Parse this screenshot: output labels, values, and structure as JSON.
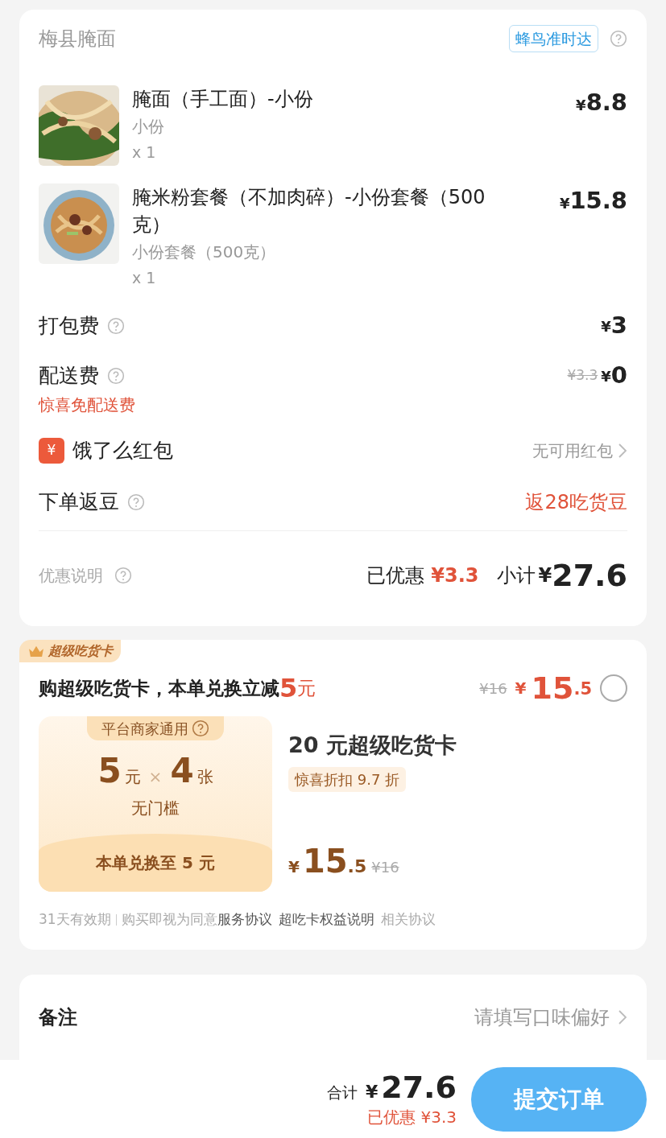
{
  "shop": {
    "name": "梅县腌面",
    "delivery_badge": "蜂鸟准时达"
  },
  "items": [
    {
      "name": "腌面（手工面）-小份",
      "spec": "小份",
      "quantity": "x 1",
      "symbol": "¥",
      "amount": "8.8",
      "kind": "picture"
    },
    {
      "name": "腌米粉套餐（不加肉碎）-小份套餐（500克）",
      "spec": "小份套餐（500克）",
      "quantity": "x 1",
      "symbol": "¥",
      "amount": "15.8",
      "kind": "picture"
    }
  ],
  "fees": [
    {
      "label": "打包费",
      "symbol": "¥",
      "amount": "3"
    },
    {
      "label": "配送费",
      "original": "¥3.3",
      "symbol": "¥",
      "amount": "0",
      "note": "惊喜免配送费"
    }
  ],
  "red_packet": {
    "icon": "¥",
    "label": "饿了么红包",
    "value": "无可用红包"
  },
  "beans": {
    "label": "下单返豆",
    "value": "返28吃货豆"
  },
  "summary": {
    "label": "优惠说明",
    "discount_label": "已优惠",
    "discount": "¥3.3",
    "subtotal_label": "小计",
    "symbol": "¥",
    "subtotal": "27.6"
  },
  "super_card": {
    "tag": "超级吃货卡",
    "headline": "购超级吃货卡，本单兑换立减",
    "headline_amount": "5",
    "headline_unit": "元",
    "original": "¥16",
    "symbol": "¥",
    "integer": "15",
    "decimal": ".5",
    "selected": false,
    "coupon": {
      "scope": "平台商家通用",
      "value": "5",
      "value_unit": "元",
      "times": "×",
      "count": "4",
      "count_unit": "张",
      "threshold": "无门槛",
      "exchange": "本单兑换至 5 元"
    },
    "title": "20 元超级吃货卡",
    "discount_tag": "惊喜折扣 9.7 折",
    "price_symbol": "¥",
    "price_integer": "15",
    "price_decimal": ".5",
    "price_original": "¥16",
    "terms": [
      {
        "text": "31天有效期",
        "kind": "plain"
      },
      {
        "text": "购买即视为同意",
        "kind": "plain"
      },
      {
        "text": "服务协议",
        "kind": "link"
      },
      {
        "text": "超吃卡权益说明",
        "kind": "link"
      },
      {
        "text": "相关协议",
        "kind": "plain"
      }
    ]
  },
  "remark": {
    "label": "备注",
    "placeholder": "请填写口味偏好"
  },
  "footer": {
    "total_label": "合计",
    "symbol": "¥",
    "total": "27.6",
    "discount": "已优惠 ¥3.3",
    "submit": "提交订单"
  }
}
